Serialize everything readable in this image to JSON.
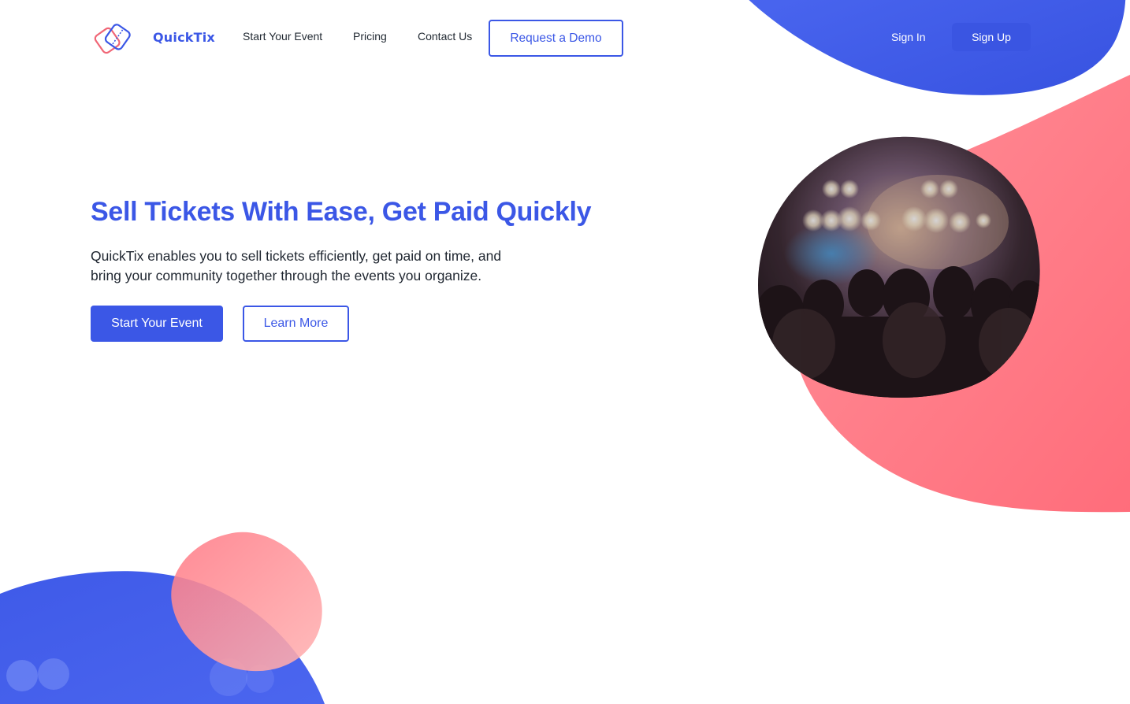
{
  "brand": {
    "name": "QuickTix",
    "logo_icon": "ticket-logo-icon",
    "primary_color": "#3b57e6",
    "accent_color": "#ff6f7d"
  },
  "nav": {
    "links": [
      "Start Your Event",
      "Pricing",
      "Contact Us"
    ],
    "demo_label": "Request a Demo",
    "signin_label": "Sign In",
    "signup_label": "Sign Up"
  },
  "hero": {
    "title": "Sell Tickets With Ease, Get Paid Quickly",
    "description": "QuickTix enables you to sell tickets efficiently, get paid on time, and bring your community together through the events you organize.",
    "primary_cta": "Start Your Event",
    "secondary_cta": "Learn More",
    "image_icon": "concert-crowd-image"
  }
}
